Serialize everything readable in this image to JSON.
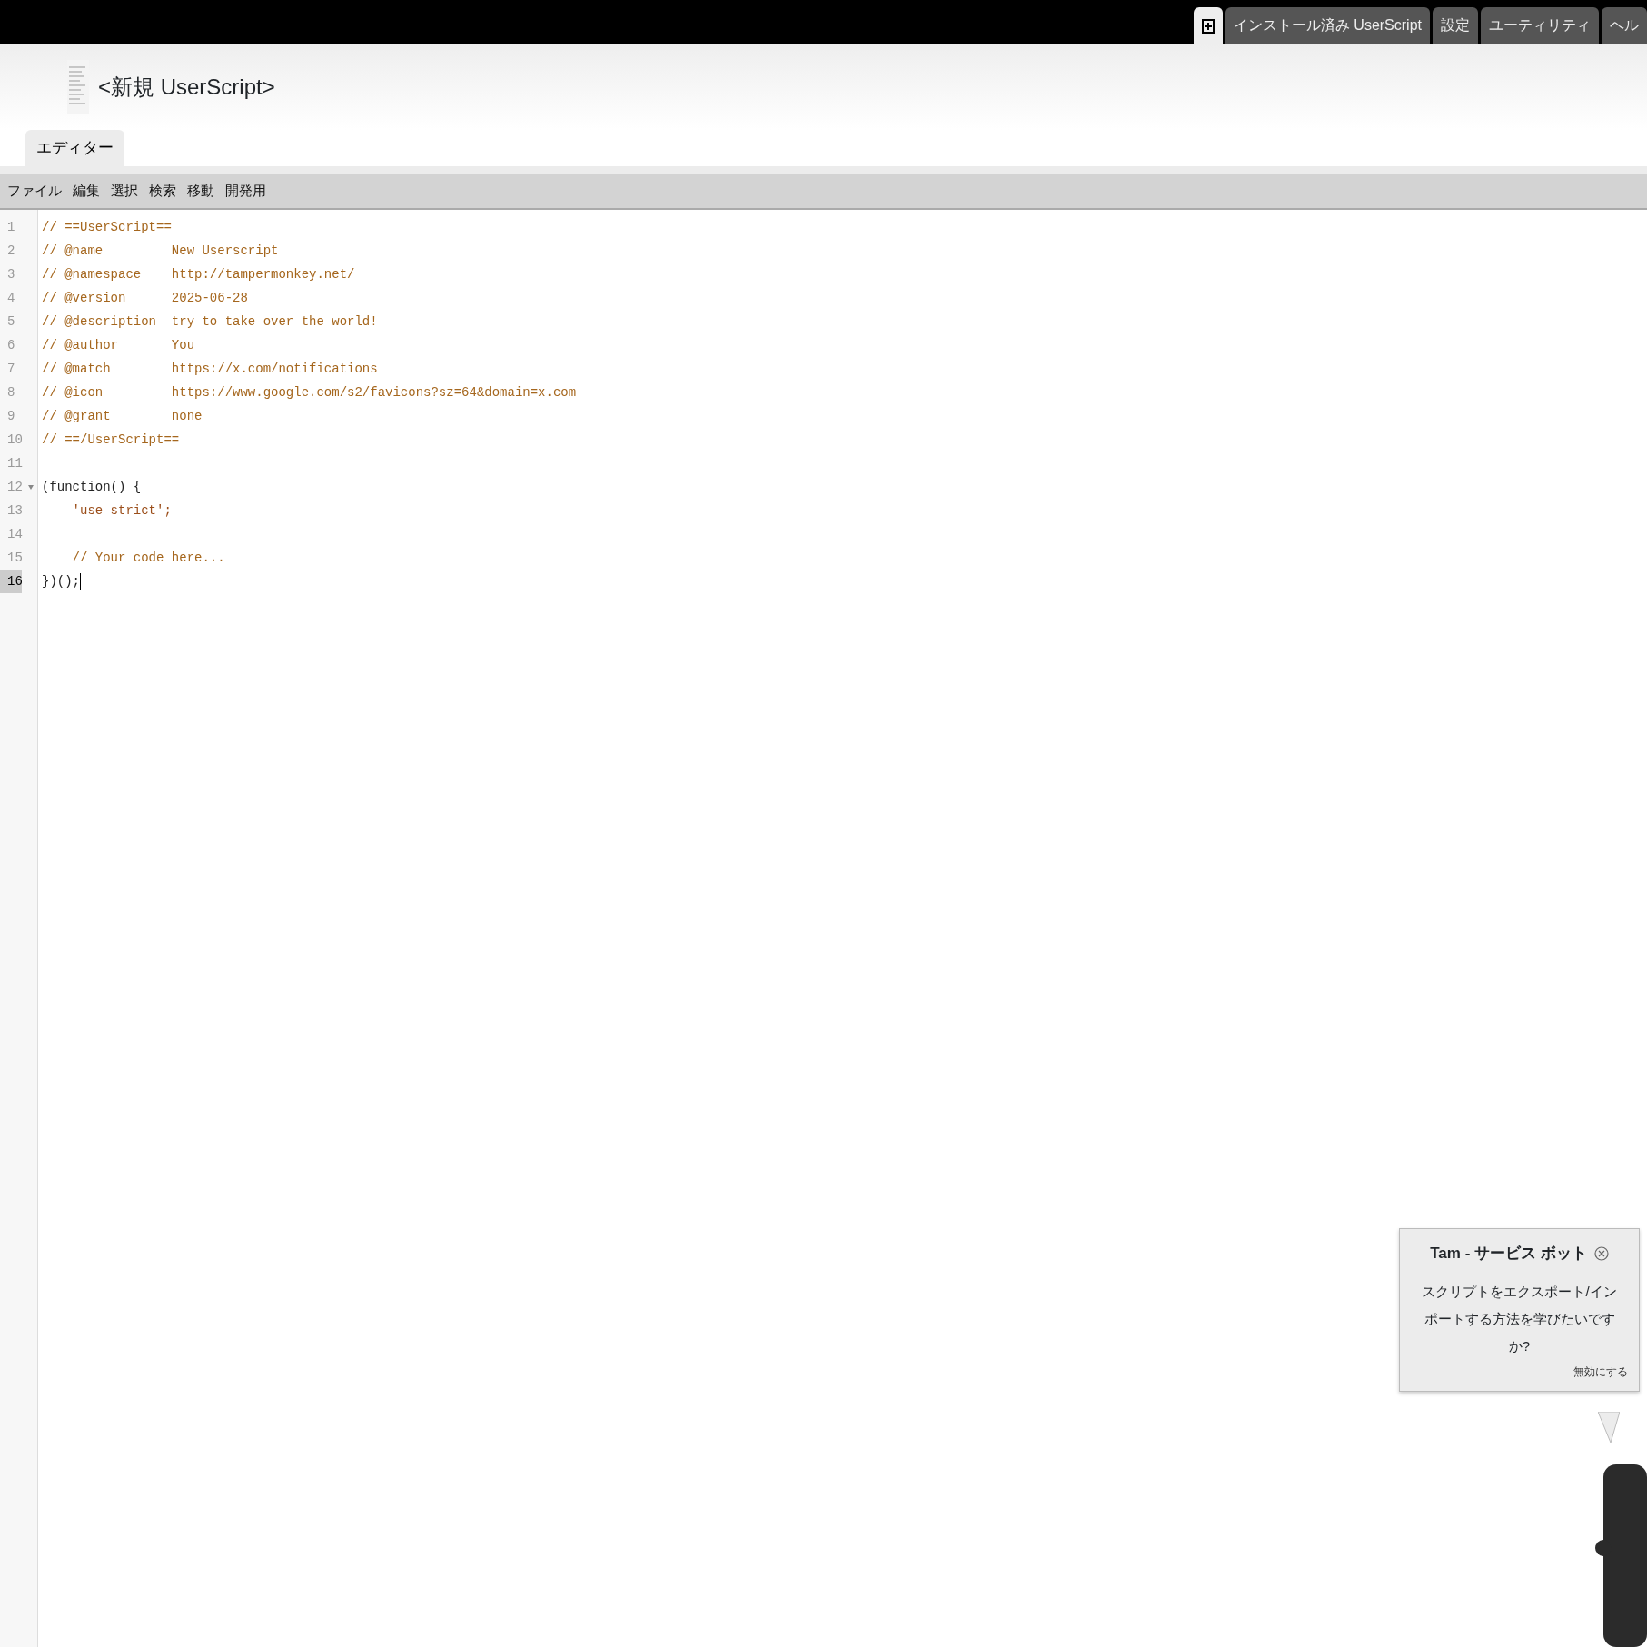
{
  "top_tabs": [
    {
      "kind": "icon",
      "selected": true
    },
    {
      "kind": "text",
      "label": "インストール済み UserScript",
      "selected": false
    },
    {
      "kind": "text",
      "label": "設定",
      "selected": false
    },
    {
      "kind": "text",
      "label": "ユーティリティ",
      "selected": false
    },
    {
      "kind": "text",
      "label": "ヘル",
      "selected": false
    }
  ],
  "header": {
    "title": "<新規 UserScript>"
  },
  "editor_tabs": [
    {
      "label": "エディター",
      "selected": true
    }
  ],
  "menu": [
    "ファイル",
    "編集",
    "選択",
    "検索",
    "移動",
    "開発用"
  ],
  "code": {
    "lines": [
      {
        "number": "1",
        "active": false,
        "foldable": false,
        "tokens": [
          {
            "kind": "comment",
            "text": "// ==UserScript=="
          }
        ]
      },
      {
        "number": "2",
        "active": false,
        "foldable": false,
        "tokens": [
          {
            "kind": "comment",
            "text": "// @name         New Userscript"
          }
        ]
      },
      {
        "number": "3",
        "active": false,
        "foldable": false,
        "tokens": [
          {
            "kind": "comment",
            "text": "// @namespace    http://tampermonkey.net/"
          }
        ]
      },
      {
        "number": "4",
        "active": false,
        "foldable": false,
        "tokens": [
          {
            "kind": "comment",
            "text": "// @version      2025-06-28"
          }
        ]
      },
      {
        "number": "5",
        "active": false,
        "foldable": false,
        "tokens": [
          {
            "kind": "comment",
            "text": "// @description  try to take over the world!"
          }
        ]
      },
      {
        "number": "6",
        "active": false,
        "foldable": false,
        "tokens": [
          {
            "kind": "comment",
            "text": "// @author       You"
          }
        ]
      },
      {
        "number": "7",
        "active": false,
        "foldable": false,
        "tokens": [
          {
            "kind": "comment",
            "text": "// @match        https://x.com/notifications"
          }
        ]
      },
      {
        "number": "8",
        "active": false,
        "foldable": false,
        "tokens": [
          {
            "kind": "comment",
            "text": "// @icon         https://www.google.com/s2/favicons?sz=64&domain=x.com"
          }
        ]
      },
      {
        "number": "9",
        "active": false,
        "foldable": false,
        "tokens": [
          {
            "kind": "comment",
            "text": "// @grant        none"
          }
        ]
      },
      {
        "number": "10",
        "active": false,
        "foldable": false,
        "tokens": [
          {
            "kind": "comment",
            "text": "// ==/UserScript=="
          }
        ]
      },
      {
        "number": "11",
        "active": false,
        "foldable": false
      },
      {
        "number": "12",
        "active": false,
        "foldable": true,
        "tokens": [
          {
            "kind": "plain",
            "text": "(function() {"
          }
        ]
      },
      {
        "number": "13",
        "active": false,
        "foldable": false,
        "tokens": [
          {
            "kind": "string",
            "text": "    'use strict';"
          }
        ]
      },
      {
        "number": "14",
        "active": false,
        "foldable": false
      },
      {
        "number": "15",
        "active": false,
        "foldable": false,
        "tokens": [
          {
            "kind": "comment",
            "text": "    // Your code here..."
          }
        ]
      },
      {
        "number": "16",
        "active": true,
        "foldable": false,
        "tokens": [
          {
            "kind": "plain",
            "text": "})();"
          }
        ]
      }
    ]
  },
  "bot": {
    "title": "Tam - サービス ボット",
    "message_lines": [
      "スクリプトをエクスポート/イン",
      "ポートする方法を学びたいです",
      "か?"
    ],
    "dismiss": "無効にする"
  }
}
